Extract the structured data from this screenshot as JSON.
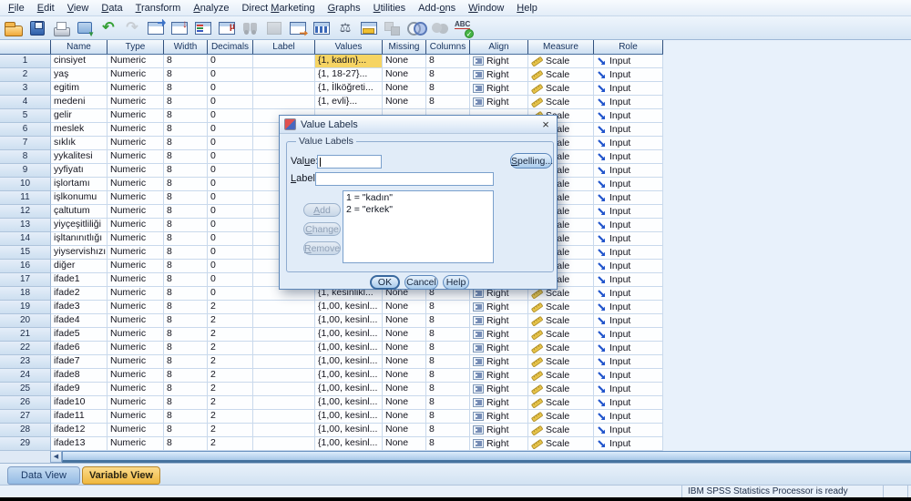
{
  "menu": {
    "items": [
      {
        "label": "File",
        "u": 0
      },
      {
        "label": "Edit",
        "u": 0
      },
      {
        "label": "View",
        "u": 0
      },
      {
        "label": "Data",
        "u": 0
      },
      {
        "label": "Transform",
        "u": 0
      },
      {
        "label": "Analyze",
        "u": 0
      },
      {
        "label": "Direct Marketing",
        "u": 7
      },
      {
        "label": "Graphs",
        "u": 0
      },
      {
        "label": "Utilities",
        "u": 0
      },
      {
        "label": "Add-ons",
        "u": 4
      },
      {
        "label": "Window",
        "u": 0
      },
      {
        "label": "Help",
        "u": 0
      }
    ]
  },
  "toolbar": {
    "icons": [
      {
        "name": "open-data",
        "disabled": false
      },
      {
        "name": "save",
        "disabled": false
      },
      {
        "name": "print",
        "disabled": false
      },
      {
        "name": "recall-dialogs",
        "disabled": false
      },
      {
        "name": "undo",
        "disabled": false
      },
      {
        "name": "redo",
        "disabled": true
      },
      {
        "name": "goto-case",
        "disabled": false
      },
      {
        "name": "goto-variable",
        "disabled": false
      },
      {
        "name": "variables",
        "disabled": false
      },
      {
        "name": "descriptives",
        "disabled": false
      },
      {
        "name": "find",
        "disabled": true
      },
      {
        "name": "insert-cases",
        "disabled": true
      },
      {
        "name": "insert-variable",
        "disabled": false
      },
      {
        "name": "split-file",
        "disabled": false
      },
      {
        "name": "weight-cases",
        "disabled": false
      },
      {
        "name": "select-cases",
        "disabled": false
      },
      {
        "name": "value-labels",
        "disabled": true
      },
      {
        "name": "use-variable-sets",
        "disabled": false
      },
      {
        "name": "show-all-variables",
        "disabled": true
      },
      {
        "name": "spell-check",
        "disabled": false
      }
    ]
  },
  "table": {
    "headers": [
      "",
      "Name",
      "Type",
      "Width",
      "Decimals",
      "Label",
      "Values",
      "Missing",
      "Columns",
      "Align",
      "Measure",
      "Role"
    ],
    "rows": [
      {
        "n": "1",
        "name": "cinsiyet",
        "type": "Numeric",
        "width": "8",
        "dec": "0",
        "label": "",
        "values": "{1, kadın}...",
        "missing": "None",
        "cols": "8",
        "align": "Right",
        "measure": "Scale",
        "role": "Input",
        "sel": true
      },
      {
        "n": "2",
        "name": "yaş",
        "type": "Numeric",
        "width": "8",
        "dec": "0",
        "label": "",
        "values": "{1, 18-27}...",
        "missing": "None",
        "cols": "8",
        "align": "Right",
        "measure": "Scale",
        "role": "Input"
      },
      {
        "n": "3",
        "name": "egitim",
        "type": "Numeric",
        "width": "8",
        "dec": "0",
        "label": "",
        "values": "{1, İlköğreti...",
        "missing": "None",
        "cols": "8",
        "align": "Right",
        "measure": "Scale",
        "role": "Input"
      },
      {
        "n": "4",
        "name": "medeni",
        "type": "Numeric",
        "width": "8",
        "dec": "0",
        "label": "",
        "values": "{1, evli}...",
        "missing": "None",
        "cols": "8",
        "align": "Right",
        "measure": "Scale",
        "role": "Input"
      },
      {
        "n": "5",
        "name": "gelir",
        "type": "Numeric",
        "width": "8",
        "dec": "0",
        "label": "",
        "values": "",
        "missing": "",
        "cols": "",
        "align": "",
        "measure": "Scale",
        "role": "Input"
      },
      {
        "n": "6",
        "name": "meslek",
        "type": "Numeric",
        "width": "8",
        "dec": "0",
        "label": "",
        "values": "",
        "missing": "",
        "cols": "",
        "align": "",
        "measure": "Scale",
        "role": "Input"
      },
      {
        "n": "7",
        "name": "sıklık",
        "type": "Numeric",
        "width": "8",
        "dec": "0",
        "label": "",
        "values": "",
        "missing": "",
        "cols": "",
        "align": "",
        "measure": "Scale",
        "role": "Input"
      },
      {
        "n": "8",
        "name": "yykalitesi",
        "type": "Numeric",
        "width": "8",
        "dec": "0",
        "label": "",
        "values": "",
        "missing": "",
        "cols": "",
        "align": "",
        "measure": "Scale",
        "role": "Input"
      },
      {
        "n": "9",
        "name": "yyfiyatı",
        "type": "Numeric",
        "width": "8",
        "dec": "0",
        "label": "",
        "values": "",
        "missing": "",
        "cols": "",
        "align": "",
        "measure": "Scale",
        "role": "Input"
      },
      {
        "n": "10",
        "name": "işlortamı",
        "type": "Numeric",
        "width": "8",
        "dec": "0",
        "label": "",
        "values": "",
        "missing": "",
        "cols": "",
        "align": "",
        "measure": "Scale",
        "role": "Input"
      },
      {
        "n": "11",
        "name": "işlkonumu",
        "type": "Numeric",
        "width": "8",
        "dec": "0",
        "label": "",
        "values": "",
        "missing": "",
        "cols": "",
        "align": "",
        "measure": "Scale",
        "role": "Input"
      },
      {
        "n": "12",
        "name": "çaltutum",
        "type": "Numeric",
        "width": "8",
        "dec": "0",
        "label": "",
        "values": "",
        "missing": "",
        "cols": "",
        "align": "",
        "measure": "Scale",
        "role": "Input"
      },
      {
        "n": "13",
        "name": "yiyçeşitliliği",
        "type": "Numeric",
        "width": "8",
        "dec": "0",
        "label": "",
        "values": "",
        "missing": "",
        "cols": "",
        "align": "",
        "measure": "Scale",
        "role": "Input"
      },
      {
        "n": "14",
        "name": "işltanınıtlığı",
        "type": "Numeric",
        "width": "8",
        "dec": "0",
        "label": "",
        "values": "",
        "missing": "",
        "cols": "",
        "align": "",
        "measure": "Scale",
        "role": "Input"
      },
      {
        "n": "15",
        "name": "yiyservishızı",
        "type": "Numeric",
        "width": "8",
        "dec": "0",
        "label": "",
        "values": "",
        "missing": "",
        "cols": "",
        "align": "",
        "measure": "Scale",
        "role": "Input"
      },
      {
        "n": "16",
        "name": "diğer",
        "type": "Numeric",
        "width": "8",
        "dec": "0",
        "label": "",
        "values": "",
        "missing": "",
        "cols": "",
        "align": "",
        "measure": "Scale",
        "role": "Input"
      },
      {
        "n": "17",
        "name": "ifade1",
        "type": "Numeric",
        "width": "8",
        "dec": "0",
        "label": "",
        "values": "",
        "missing": "",
        "cols": "",
        "align": "",
        "measure": "Scale",
        "role": "Input"
      },
      {
        "n": "18",
        "name": "ifade2",
        "type": "Numeric",
        "width": "8",
        "dec": "0",
        "label": "",
        "values": "{1, kesinlikl...",
        "missing": "None",
        "cols": "8",
        "align": "Right",
        "measure": "Scale",
        "role": "Input"
      },
      {
        "n": "19",
        "name": "ifade3",
        "type": "Numeric",
        "width": "8",
        "dec": "2",
        "label": "",
        "values": "{1,00, kesinl...",
        "missing": "None",
        "cols": "8",
        "align": "Right",
        "measure": "Scale",
        "role": "Input"
      },
      {
        "n": "20",
        "name": "ifade4",
        "type": "Numeric",
        "width": "8",
        "dec": "2",
        "label": "",
        "values": "{1,00, kesinl...",
        "missing": "None",
        "cols": "8",
        "align": "Right",
        "measure": "Scale",
        "role": "Input"
      },
      {
        "n": "21",
        "name": "ifade5",
        "type": "Numeric",
        "width": "8",
        "dec": "2",
        "label": "",
        "values": "{1,00, kesinl...",
        "missing": "None",
        "cols": "8",
        "align": "Right",
        "measure": "Scale",
        "role": "Input"
      },
      {
        "n": "22",
        "name": "ifade6",
        "type": "Numeric",
        "width": "8",
        "dec": "2",
        "label": "",
        "values": "{1,00, kesinl...",
        "missing": "None",
        "cols": "8",
        "align": "Right",
        "measure": "Scale",
        "role": "Input"
      },
      {
        "n": "23",
        "name": "ifade7",
        "type": "Numeric",
        "width": "8",
        "dec": "2",
        "label": "",
        "values": "{1,00, kesinl...",
        "missing": "None",
        "cols": "8",
        "align": "Right",
        "measure": "Scale",
        "role": "Input"
      },
      {
        "n": "24",
        "name": "ifade8",
        "type": "Numeric",
        "width": "8",
        "dec": "2",
        "label": "",
        "values": "{1,00, kesinl...",
        "missing": "None",
        "cols": "8",
        "align": "Right",
        "measure": "Scale",
        "role": "Input"
      },
      {
        "n": "25",
        "name": "ifade9",
        "type": "Numeric",
        "width": "8",
        "dec": "2",
        "label": "",
        "values": "{1,00, kesinl...",
        "missing": "None",
        "cols": "8",
        "align": "Right",
        "measure": "Scale",
        "role": "Input"
      },
      {
        "n": "26",
        "name": "ifade10",
        "type": "Numeric",
        "width": "8",
        "dec": "2",
        "label": "",
        "values": "{1,00, kesinl...",
        "missing": "None",
        "cols": "8",
        "align": "Right",
        "measure": "Scale",
        "role": "Input"
      },
      {
        "n": "27",
        "name": "ifade11",
        "type": "Numeric",
        "width": "8",
        "dec": "2",
        "label": "",
        "values": "{1,00, kesinl...",
        "missing": "None",
        "cols": "8",
        "align": "Right",
        "measure": "Scale",
        "role": "Input"
      },
      {
        "n": "28",
        "name": "ifade12",
        "type": "Numeric",
        "width": "8",
        "dec": "2",
        "label": "",
        "values": "{1,00, kesinl...",
        "missing": "None",
        "cols": "8",
        "align": "Right",
        "measure": "Scale",
        "role": "Input"
      },
      {
        "n": "29",
        "name": "ifade13",
        "type": "Numeric",
        "width": "8",
        "dec": "2",
        "label": "",
        "values": "{1,00, kesinl...",
        "missing": "None",
        "cols": "8",
        "align": "Right",
        "measure": "Scale",
        "role": "Input"
      }
    ]
  },
  "dialog": {
    "title": "Value Labels",
    "close_glyph": "×",
    "group_title": "Value Labels",
    "value_label": "Value:",
    "value_input": "",
    "label_label": "Label:",
    "label_input": "",
    "spelling_button": "Spelling...",
    "add_button": "Add",
    "change_button": "Change",
    "remove_button": "Remove",
    "list_items": [
      "1 = \"kadın\"",
      "2 = \"erkek\""
    ],
    "ok_button": "OK",
    "cancel_button": "Cancel",
    "help_button": "Help"
  },
  "scrollbar": {
    "left_arrow": "◀"
  },
  "tabs": {
    "data_view": "Data View",
    "variable_view": "Variable View",
    "active": "Variable View"
  },
  "status_bar": {
    "message": "IBM SPSS Statistics Processor is ready"
  },
  "colors": {
    "accent_selection": "#f6d463",
    "active_tab": "#efb83e",
    "toolbar_bg": "#d6e5f4"
  }
}
